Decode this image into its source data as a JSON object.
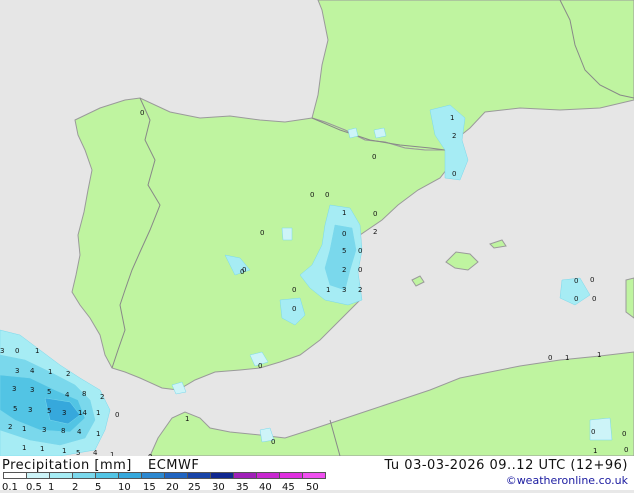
{
  "legend": {
    "title": "Precipitation [mm]",
    "model": "ECMWF",
    "datetime": "Tu 03-03-2026 09..12 UTC (12+96)",
    "credit": "©weatheronline.co.uk",
    "ticks": [
      "0.1",
      "0.5",
      "1",
      "2",
      "5",
      "10",
      "15",
      "20",
      "25",
      "30",
      "35",
      "40",
      "45",
      "50"
    ],
    "colors": [
      "#ffffff",
      "#cdf4f8",
      "#a6ecf4",
      "#7ad8ec",
      "#52c4e4",
      "#36a8dc",
      "#2c88d0",
      "#2064c0",
      "#1844a8",
      "#102890",
      "#a020b8",
      "#c828d0",
      "#e030e0",
      "#f050f0"
    ]
  },
  "map_colors": {
    "sea": "#e6e6e6",
    "land": "#bff4a0",
    "coast": "#9a9a9a",
    "border": "#888888"
  },
  "values": [
    {
      "t": "0"
    },
    {
      "t": "1"
    },
    {
      "t": "2"
    },
    {
      "t": "0"
    },
    {
      "t": "0"
    },
    {
      "t": "0"
    },
    {
      "t": "0"
    },
    {
      "t": "1"
    },
    {
      "t": "0"
    },
    {
      "t": "0"
    },
    {
      "t": "0"
    },
    {
      "t": "2"
    },
    {
      "t": "5"
    },
    {
      "t": "0"
    },
    {
      "t": "2"
    },
    {
      "t": "0"
    },
    {
      "t": "1"
    },
    {
      "t": "3"
    },
    {
      "t": "2"
    },
    {
      "t": "0"
    },
    {
      "t": "0"
    },
    {
      "t": "0"
    },
    {
      "t": "0"
    },
    {
      "t": "0"
    },
    {
      "t": "0"
    },
    {
      "t": "0"
    },
    {
      "t": "0"
    },
    {
      "t": "1"
    },
    {
      "t": "3"
    },
    {
      "t": "0"
    },
    {
      "t": "1"
    },
    {
      "t": "0"
    },
    {
      "t": "3"
    },
    {
      "t": "4"
    },
    {
      "t": "1"
    },
    {
      "t": "2"
    },
    {
      "t": "3"
    },
    {
      "t": "3"
    },
    {
      "t": "5"
    },
    {
      "t": "4"
    },
    {
      "t": "8"
    },
    {
      "t": "2"
    },
    {
      "t": "5"
    },
    {
      "t": "3"
    },
    {
      "t": "5"
    },
    {
      "t": "3"
    },
    {
      "t": "14"
    },
    {
      "t": "1"
    },
    {
      "t": "0"
    },
    {
      "t": "2"
    },
    {
      "t": "1"
    },
    {
      "t": "3"
    },
    {
      "t": "8"
    },
    {
      "t": "4"
    },
    {
      "t": "1"
    },
    {
      "t": "1"
    },
    {
      "t": "1"
    },
    {
      "t": "1"
    },
    {
      "t": "5"
    },
    {
      "t": "4"
    },
    {
      "t": "1"
    },
    {
      "t": "1"
    },
    {
      "t": "0"
    },
    {
      "t": "0"
    },
    {
      "t": "0"
    },
    {
      "t": "0"
    },
    {
      "t": "1"
    },
    {
      "t": "0"
    },
    {
      "t": "0"
    },
    {
      "t": "1"
    }
  ]
}
